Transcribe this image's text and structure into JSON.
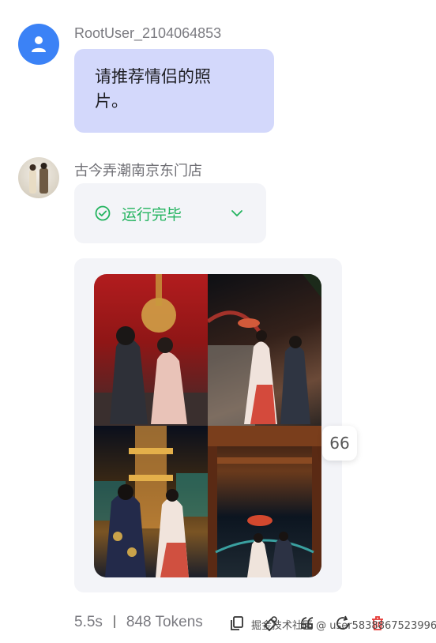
{
  "user_message": {
    "username": "RootUser_2104064853",
    "text_line1": "请推荐情侣的照",
    "text_line2": "片。",
    "avatar_icon": "user-icon"
  },
  "assistant_message": {
    "name": "古今弄潮南京东门店",
    "status": "运行完毕",
    "status_color": "#22b35e",
    "quote_badge": "66",
    "images": [
      {
        "description_icon": "couple-photo-red-wall"
      },
      {
        "description_icon": "couple-photo-bridge-night"
      },
      {
        "description_icon": "couple-photo-pagoda-night"
      },
      {
        "description_icon": "couple-photo-gate-lantern"
      }
    ]
  },
  "footer": {
    "duration": "5.5s",
    "tokens": "848 Tokens",
    "watermark": "掘金技术社区 @ user5838867523996"
  },
  "colors": {
    "user_bubble": "#d3d8fb",
    "user_avatar": "#3b82f6",
    "card_bg": "#f3f4f8",
    "delete": "#e53935"
  }
}
